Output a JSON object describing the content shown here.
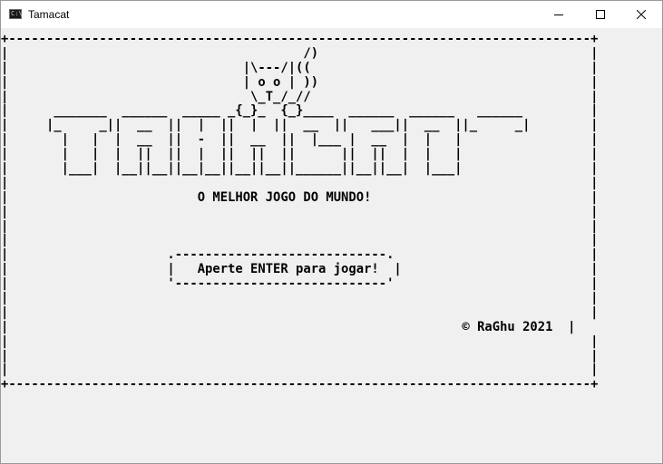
{
  "window": {
    "title": "Tamacat",
    "icon": "console-icon",
    "icon_glyph": "C:\\"
  },
  "console": {
    "lines": [
      "+-----------------------------------------------------------------------------+",
      "|                                       /)                                    |",
      "|                               |\\---/|((                                     |",
      "|                               | o o | ))                                    |",
      "|                                \\_T_/_//                                     |",
      "|      _______  ______  _____ _{_}_  {_}____  ______  ______   ______         |",
      "|     |_     _||  __  ||  |  ||  |  ||  __  ||   ___||  __  ||_     _|        |",
      "|       |   |  |  __  ||  -  ||  __  ||  |___ |  __  |  |   |                 |",
      "|       |   |  |  ||  ||  |  ||  ||  ||      ||  ||  |  |   |                 |",
      "|       |___|  |__||__||__|__||__||__||______||__||__|  |___|                 |",
      "|                                                                             |",
      "|                         O MELHOR JOGO DO MUNDO!                             |",
      "|                                                                             |",
      "|                                                                             |",
      "|                                                                             |",
      "|                     .----------------------------.                          |",
      "|                     |   Aperte ENTER para jogar!  |                         |",
      "|                     '----------------------------'                          |",
      "|                                                                             |",
      "|                                                                             |",
      "|                                                            © RaGhu 2021  |",
      "|                                                                             |",
      "|                                                                             |",
      "|                                                                             |",
      "+-----------------------------------------------------------------------------+"
    ]
  }
}
